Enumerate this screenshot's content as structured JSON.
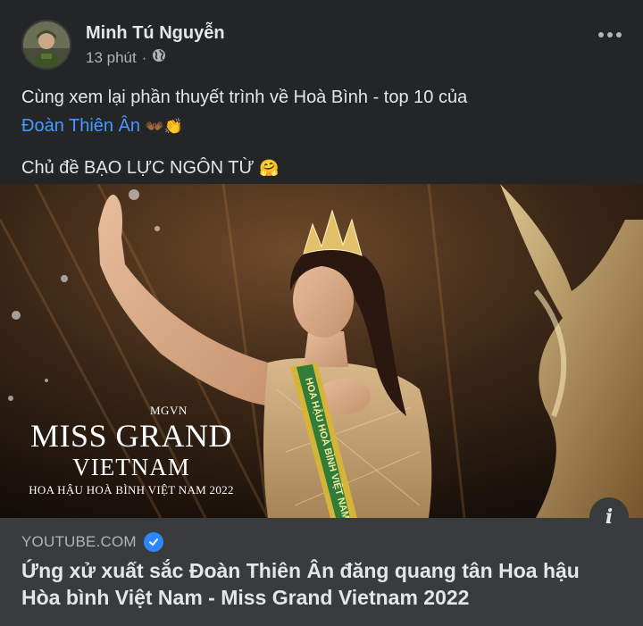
{
  "post": {
    "author_name": "Minh Tú Nguyễn",
    "timestamp": "13 phút",
    "separator": "·",
    "text_line1": "Cùng xem lại phần thuyết trình về Hoà Bình - top 10 của",
    "mention": "Đoàn Thiên Ân",
    "mention_emoji": "👐🏾👏",
    "text_line2": "Chủ đề BẠO LỰC NGÔN TỪ",
    "line2_emoji": "🤗"
  },
  "media": {
    "logo_tag": "MGVN",
    "logo_line1": "MISS GRAND",
    "logo_line2": "VIETNAM",
    "logo_sub": "HOA HẬU HOÀ BÌNH VIỆT NAM 2022",
    "sash_text": "HOA HẬU HOÀ BÌNH VIỆT NAM"
  },
  "link_preview": {
    "domain": "YOUTUBE.COM",
    "headline": "Ứng xử xuất sắc Đoàn Thiên Ân đăng quang tân Hoa hậu Hòa bình Việt Nam - Miss Grand Vietnam 2022"
  },
  "icons": {
    "globe": "globe-icon",
    "more": "more-options-icon",
    "info": "info-icon",
    "verified": "verified-check-icon"
  },
  "colors": {
    "card_bg": "#242526",
    "preview_bg": "#3a3b3c",
    "mention": "#4599ff",
    "verified": "#2d88ff",
    "text_primary": "#e4e6eb",
    "text_secondary": "#b0b3b8"
  }
}
